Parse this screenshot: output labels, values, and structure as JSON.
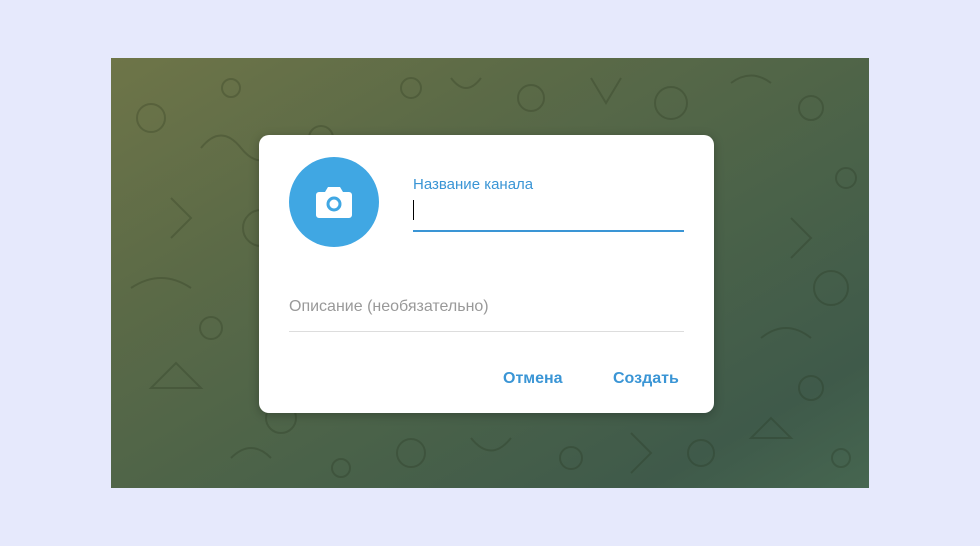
{
  "colors": {
    "accent": "#40a7e3",
    "link": "#3a95d5",
    "page_background": "#e6e9fc",
    "dialog_background": "#ffffff",
    "placeholder": "#999999"
  },
  "photo_button": {
    "icon": "camera-icon"
  },
  "channel_name": {
    "label": "Название канала",
    "value": ""
  },
  "description": {
    "placeholder": "Описание (необязательно)",
    "value": ""
  },
  "actions": {
    "cancel_label": "Отмена",
    "create_label": "Создать"
  }
}
